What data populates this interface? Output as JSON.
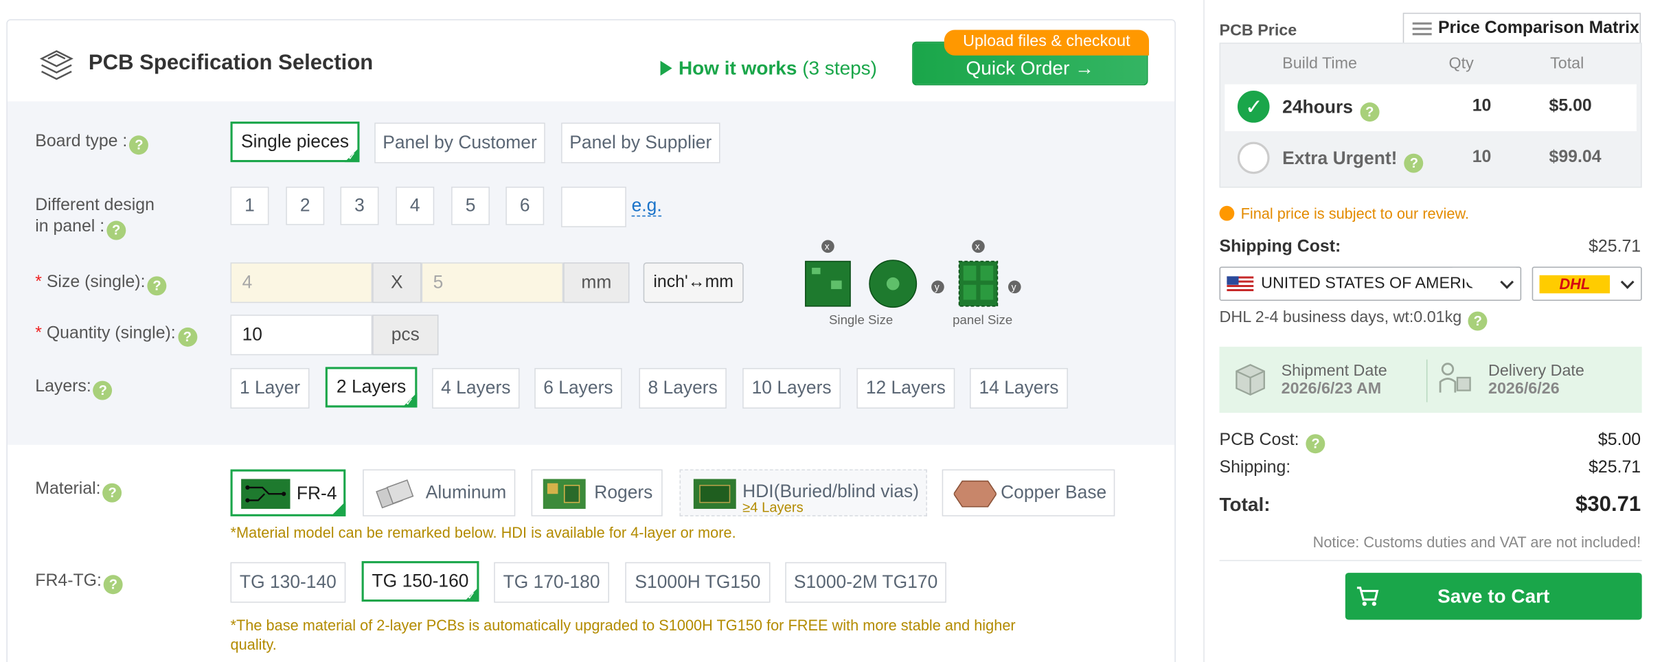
{
  "header": {
    "title": "PCB Specification Selection",
    "how_it_works": "How it works",
    "steps": "(3 steps)",
    "quick_order": "Quick Order",
    "upload_tag": "Upload files & checkout"
  },
  "board_type": {
    "label": "Board type :",
    "options": [
      "Single pieces",
      "Panel by Customer",
      "Panel by Supplier"
    ],
    "selected": "Single pieces"
  },
  "design": {
    "label_line1": "Different design",
    "label_line2": "in panel :",
    "options": [
      "1",
      "2",
      "3",
      "4",
      "5",
      "6"
    ],
    "eg": "e.g."
  },
  "size": {
    "label": "Size (single):",
    "x_value": "4",
    "x_sep": "X",
    "y_value": "5",
    "unit": "mm",
    "convert_button": "inch'↔mm",
    "single_size_label": "Single Size",
    "panel_size_label": "panel Size"
  },
  "quantity": {
    "label": "Quantity (single):",
    "value": "10",
    "unit": "pcs"
  },
  "layers": {
    "label": "Layers:",
    "options": [
      "1 Layer",
      "2 Layers",
      "4 Layers",
      "6 Layers",
      "8 Layers",
      "10 Layers",
      "12 Layers",
      "14 Layers"
    ],
    "selected": "2 Layers"
  },
  "material": {
    "label": "Material:",
    "options": [
      "FR-4",
      "Aluminum",
      "Rogers",
      "HDI(Buried/blind vias)",
      "Copper Base"
    ],
    "hdi_sub": "≥4 Layers",
    "selected": "FR-4",
    "note": "*Material model can be remarked below. HDI is available for 4-layer or more."
  },
  "tg": {
    "label": "FR4-TG:",
    "options": [
      "TG 130-140",
      "TG 150-160",
      "TG 170-180",
      "S1000H TG150",
      "S1000-2M TG170"
    ],
    "selected": "TG 150-160",
    "note_line1": "*The base material of 2-layer PCBs is automatically upgraded to S1000H TG150 for FREE with more stable and higher",
    "note_line2": "quality."
  },
  "price_panel": {
    "title": "PCB Price",
    "matrix_button": "Price Comparison Matrix",
    "columns": [
      "Build Time",
      "Qty",
      "Total"
    ],
    "rows": [
      {
        "build_time": "24hours",
        "qty": "10",
        "total": "$5.00"
      },
      {
        "build_time": "Extra Urgent!",
        "qty": "10",
        "total": "$99.04"
      }
    ],
    "final_note": "Final price is subject to our review.",
    "shipping_label": "Shipping Cost:",
    "shipping_value": "$25.71",
    "country": "UNITED STATES OF AMERICA",
    "carrier": "DHL",
    "carrier_info": "DHL   2-4 business days, wt:0.01kg",
    "shipment_label": "Shipment Date",
    "shipment_date": "2026/6/23 AM",
    "delivery_label": "Delivery Date",
    "delivery_date": "2026/6/26",
    "pcb_cost_label": "PCB Cost:",
    "pcb_cost_value": "$5.00",
    "shipping_row_label": "Shipping:",
    "shipping_row_value": "$25.71",
    "total_label": "Total:",
    "total_value": "$30.71",
    "notice": "Notice: Customs duties and VAT are not included!",
    "save_button": "Save to Cart"
  },
  "colors": {
    "accent": "#1aa64a",
    "orange": "#ff9800",
    "note": "#b38b00"
  }
}
